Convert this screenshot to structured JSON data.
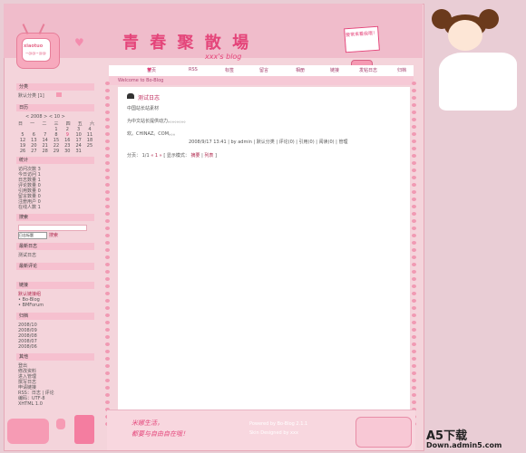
{
  "header": {
    "tv_logo": "xiaotuo",
    "tv_sub": "~@@~@@",
    "site_title": "青 春 聚 散 場",
    "site_sub": "xxx's blog",
    "sticker_text": "要常来看我哦！"
  },
  "nav": {
    "items": [
      "首页",
      "RSS",
      "标签",
      "留言",
      "相册",
      "链接",
      "发帖日志",
      "归档"
    ]
  },
  "welcome": "Welcome to Bo-Blog",
  "post": {
    "title": "测试日志",
    "line1": "中国站长站素材",
    "line2": "为中文站长提供动力。。。。。。。。",
    "line3": "欢。CHINAZ。COM。。。",
    "meta": "2008/9/17 13:41 | by admin | 默认分类 | 评论(0) | 引用(0) | 阅读(0) | 管理",
    "pager_prefix": "分页：",
    "pager_pages": "1/1",
    "pager_nav": "« 1 »",
    "pager_mode_prefix": "[ 显示模式：",
    "pager_mode_summary": "摘要",
    "pager_mode_sep": "|",
    "pager_mode_list": "列表",
    "pager_mode_suffix": "]"
  },
  "sidebar": {
    "category": {
      "title": "分类",
      "item": "默认分类 [1]"
    },
    "calendar": {
      "title": "日历",
      "nav": "< 2008 > < 10 >",
      "weekdays": [
        "日",
        "一",
        "二",
        "三",
        "四",
        "五",
        "六"
      ],
      "rows": [
        [
          "",
          "",
          "",
          "1",
          "2",
          "3",
          "4"
        ],
        [
          "5",
          "6",
          "7",
          "8",
          "9",
          "10",
          "11"
        ],
        [
          "12",
          "13",
          "14",
          "15",
          "16",
          "17",
          "18"
        ],
        [
          "19",
          "20",
          "21",
          "22",
          "23",
          "24",
          "25"
        ],
        [
          "26",
          "27",
          "28",
          "29",
          "30",
          "31",
          ""
        ]
      ],
      "today": "9"
    },
    "stats": {
      "title": "统计",
      "lines": [
        "访问次数 3",
        "今日访问 1",
        "日志数量 1",
        "评论数量 0",
        "引用数量 0",
        "留言数量 0",
        "注册用户 0",
        "在线人数 1"
      ]
    },
    "search": {
      "title": "搜索",
      "select_value": "日志标题",
      "button": "搜索"
    },
    "recent_posts": {
      "title": "最新日志",
      "item": "测试日志"
    },
    "recent_comments": {
      "title": "最新评论"
    },
    "links": {
      "title": "链接",
      "category": "默认链接组",
      "items": [
        "Bo-Blog",
        "BMForum"
      ]
    },
    "archive": {
      "title": "归档",
      "items": [
        "2008/10",
        "2008/09",
        "2008/08",
        "2008/07",
        "2008/06"
      ]
    },
    "other": {
      "title": "其他",
      "items": [
        "登出",
        "修改资料",
        "进入管理",
        "撰写日志",
        "申请链接"
      ],
      "rss_line": "RSS：日志 | 评论",
      "encode_line": "编码：UTF-8",
      "xhtml_line": "XHTML 1.0"
    }
  },
  "footer": {
    "left1": "米娜生活，",
    "left2": "都要与自由自在哦！",
    "right1": "Powered by Bo-Blog 2.1.1",
    "right2": "Skin Designed by xxx"
  },
  "watermark": {
    "brand": "A5下载",
    "domain": "Down.admin5.com"
  },
  "colors": {
    "background": "#e9cdd5",
    "accent": "#e4457a",
    "panel": "#f4d4db"
  }
}
